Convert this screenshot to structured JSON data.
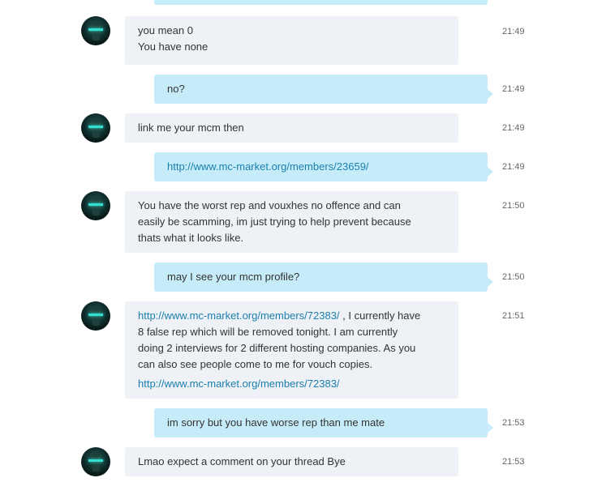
{
  "messages": [
    {
      "sender": "them",
      "lines": [
        "you mean 0",
        "You have none"
      ],
      "time": "21:49"
    },
    {
      "sender": "me",
      "lines": [
        "no?"
      ],
      "time": "21:49"
    },
    {
      "sender": "them",
      "lines": [
        "link me your mcm then"
      ],
      "time": "21:49"
    },
    {
      "sender": "me",
      "link": "http://www.mc-market.org/members/23659/",
      "time": "21:49"
    },
    {
      "sender": "them",
      "lines": [
        "You have the worst rep and vouxhes no offence and can",
        "easily be scamming, im just trying to help prevent because",
        "thats what it looks like."
      ],
      "time": "21:50"
    },
    {
      "sender": "me",
      "lines": [
        "may I see your mcm profile?"
      ],
      "time": "21:50"
    },
    {
      "sender": "them",
      "link": "http://www.mc-market.org/members/72383/",
      "line1_rest": " , I currently have",
      "lines": [
        "8 false rep which will be removed tonight. I am currently",
        "doing 2 interviews for 2 different hosting companies. As you",
        "can also see people come to me for vouch copies."
      ],
      "link2": "http://www.mc-market.org/members/72383/",
      "time": "21:51"
    },
    {
      "sender": "me",
      "lines": [
        "im sorry but you have worse rep than me mate"
      ],
      "time": "21:53"
    },
    {
      "sender": "them",
      "lines": [
        "Lmao expect a comment on your thread Bye"
      ],
      "time": "21:53"
    }
  ]
}
